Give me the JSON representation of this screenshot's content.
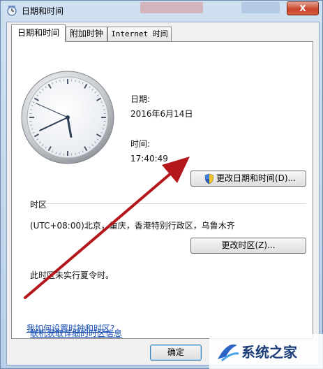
{
  "window": {
    "title": "日期和时间",
    "close_label": "X"
  },
  "tabs": [
    {
      "label": "日期和时间"
    },
    {
      "label": "附加时钟"
    },
    {
      "label": "Internet 时间"
    }
  ],
  "datetime": {
    "date_label": "日期:",
    "date_value": "2016年6月14日",
    "time_label": "时间:",
    "time_value": "17:40:49",
    "change_datetime_label": "更改日期和时间(D)..."
  },
  "timezone": {
    "section_label": "时区",
    "zone_value": "(UTC+08:00)北京，重庆，香港特别行政区，乌鲁木齐",
    "change_zone_label": "更改时区(Z)...",
    "dst_note": "此时区未实行夏令时。"
  },
  "links": {
    "online_info": "联机获取详细的时区信息",
    "how_to_set": "我如何设置时钟和时区?"
  },
  "footer": {
    "ok_label": "确定"
  },
  "watermark": {
    "text": "系统之家"
  },
  "colors": {
    "arrow": "#b5161b",
    "link": "#1a4fb4",
    "title_bar": "#cfe0f1"
  },
  "clock": {
    "hours": 17,
    "minutes": 40,
    "seconds": 49
  },
  "icons": {
    "title": "datetime-app-icon",
    "shield": "uac-shield-icon",
    "clock": "analog-clock-icon"
  }
}
